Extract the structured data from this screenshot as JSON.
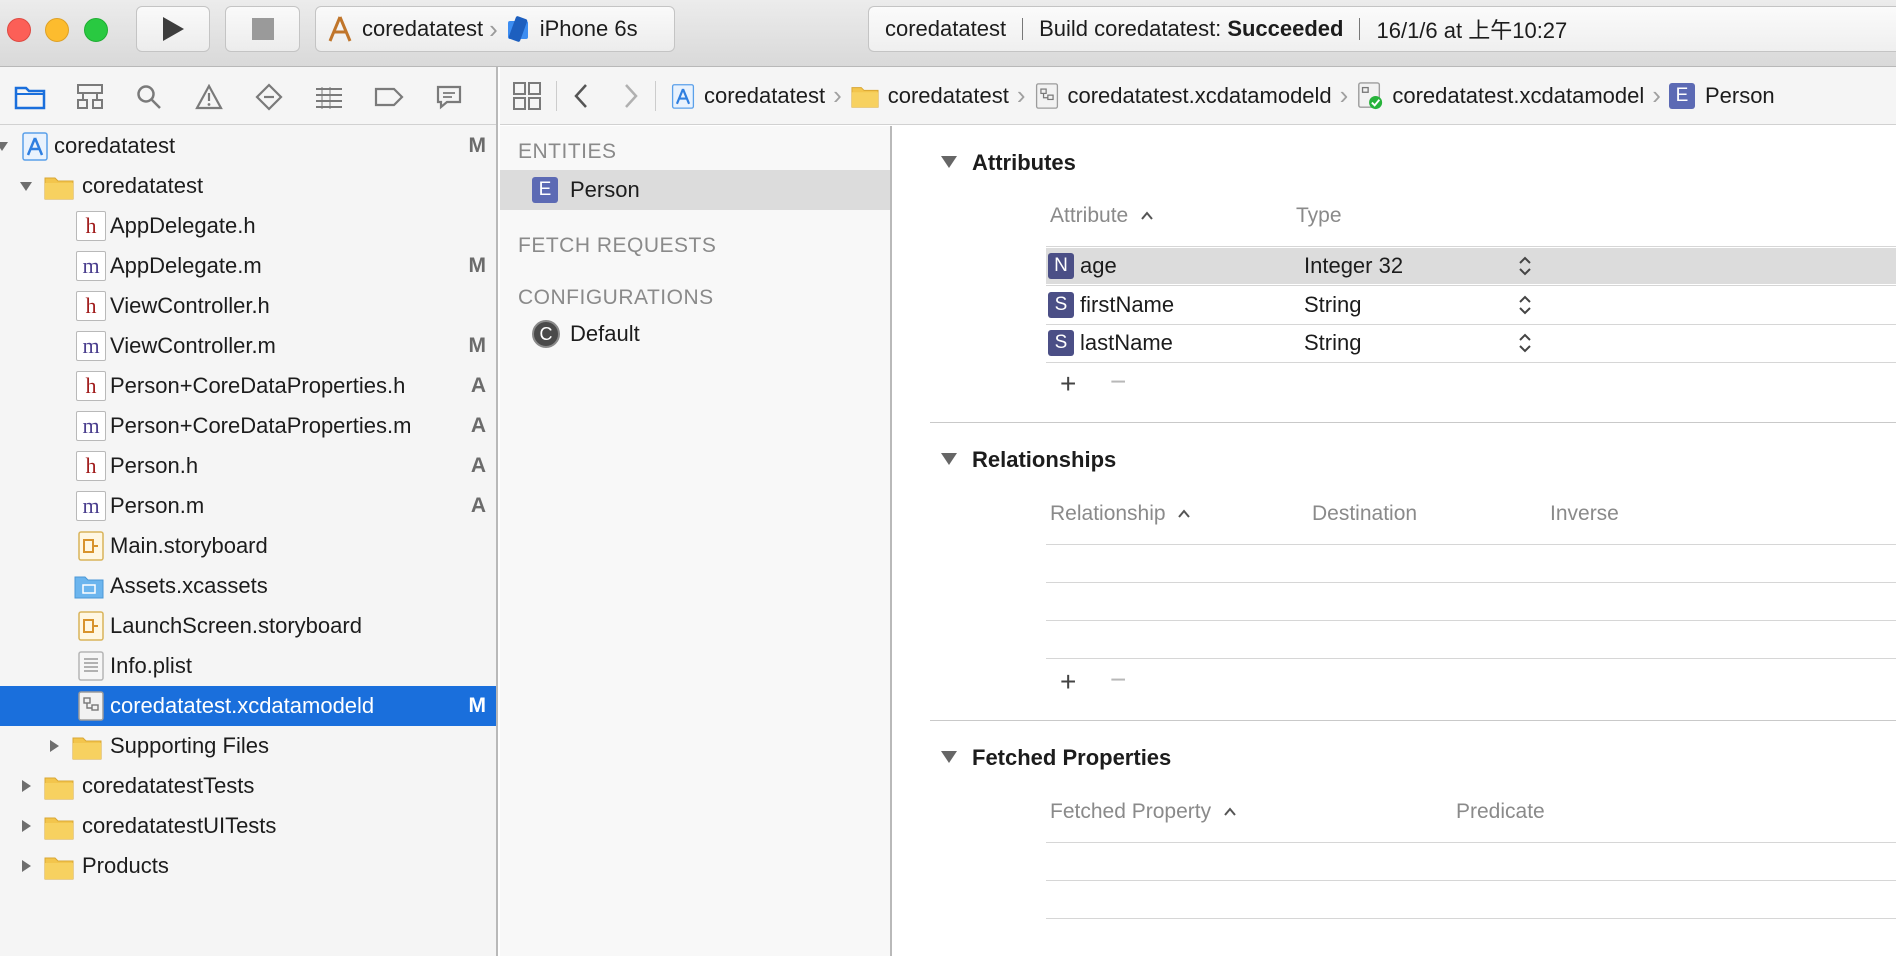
{
  "titlebar": {
    "scheme": "coredatatest",
    "device": "iPhone 6s",
    "activity": {
      "project": "coredatatest",
      "status_prefix": "Build coredatatest:",
      "status": "Succeeded",
      "timestamp": "16/1/6 at 上午10:27"
    }
  },
  "navigator": {
    "items": [
      {
        "label": "coredatatest",
        "badge": "M"
      },
      {
        "label": "coredatatest",
        "badge": ""
      },
      {
        "label": "AppDelegate.h",
        "badge": ""
      },
      {
        "label": "AppDelegate.m",
        "badge": "M"
      },
      {
        "label": "ViewController.h",
        "badge": ""
      },
      {
        "label": "ViewController.m",
        "badge": "M"
      },
      {
        "label": "Person+CoreDataProperties.h",
        "badge": "A"
      },
      {
        "label": "Person+CoreDataProperties.m",
        "badge": "A"
      },
      {
        "label": "Person.h",
        "badge": "A"
      },
      {
        "label": "Person.m",
        "badge": "A"
      },
      {
        "label": "Main.storyboard",
        "badge": ""
      },
      {
        "label": "Assets.xcassets",
        "badge": ""
      },
      {
        "label": "LaunchScreen.storyboard",
        "badge": ""
      },
      {
        "label": "Info.plist",
        "badge": ""
      },
      {
        "label": "coredatatest.xcdatamodeld",
        "badge": "M"
      },
      {
        "label": "Supporting Files",
        "badge": ""
      },
      {
        "label": "coredatatestTests",
        "badge": ""
      },
      {
        "label": "coredatatestUITests",
        "badge": ""
      },
      {
        "label": "Products",
        "badge": ""
      }
    ]
  },
  "jumpbar": {
    "crumbs": [
      "coredatatest",
      "coredatatest",
      "coredatatest.xcdatamodeld",
      "coredatatest.xcdatamodel",
      "Person"
    ]
  },
  "entities_panel": {
    "entities_header": "ENTITIES",
    "entity": "Person",
    "fetch_header": "FETCH REQUESTS",
    "config_header": "CONFIGURATIONS",
    "configuration": "Default"
  },
  "attributes": {
    "title": "Attributes",
    "col_attribute": "Attribute",
    "col_type": "Type",
    "rows": [
      {
        "tag": "N",
        "name": "age",
        "type": "Integer 32"
      },
      {
        "tag": "S",
        "name": "firstName",
        "type": "String"
      },
      {
        "tag": "S",
        "name": "lastName",
        "type": "String"
      }
    ]
  },
  "relationships": {
    "title": "Relationships",
    "col_relationship": "Relationship",
    "col_destination": "Destination",
    "col_inverse": "Inverse"
  },
  "fetched_properties": {
    "title": "Fetched Properties",
    "col_property": "Fetched Property",
    "col_predicate": "Predicate"
  },
  "icons": {
    "entity_tag": "E",
    "config_tag": "C"
  }
}
